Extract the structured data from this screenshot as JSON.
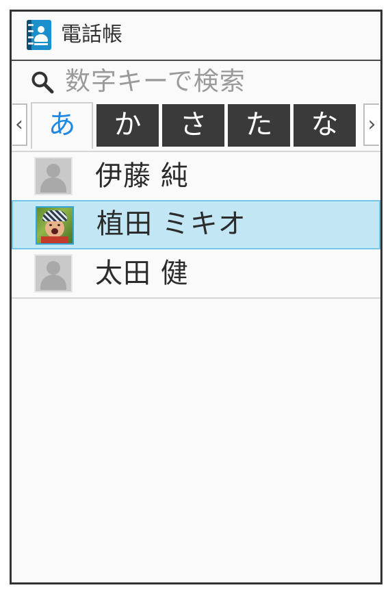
{
  "app": {
    "title": "電話帳",
    "icon": "contacts-book-icon",
    "accent": "#1e88e5"
  },
  "search": {
    "placeholder": "数字キーで検索",
    "icon": "search-icon"
  },
  "index_tabs": {
    "prev_icon": "chevron-left-icon",
    "next_icon": "chevron-right-icon",
    "items": [
      {
        "label": "あ",
        "active": true
      },
      {
        "label": "か",
        "active": false
      },
      {
        "label": "さ",
        "active": false
      },
      {
        "label": "た",
        "active": false
      },
      {
        "label": "な",
        "active": false
      }
    ]
  },
  "contacts": [
    {
      "name": "伊藤 純",
      "avatar": "default-avatar-icon",
      "selected": false
    },
    {
      "name": "植田 ミキオ",
      "avatar": "photo",
      "selected": true
    },
    {
      "name": "太田 健",
      "avatar": "default-avatar-icon",
      "selected": false
    }
  ],
  "colors": {
    "selected_row": "#c2e6f4",
    "selected_border": "#74c6e6",
    "tab_bg": "#3a3a3a"
  }
}
